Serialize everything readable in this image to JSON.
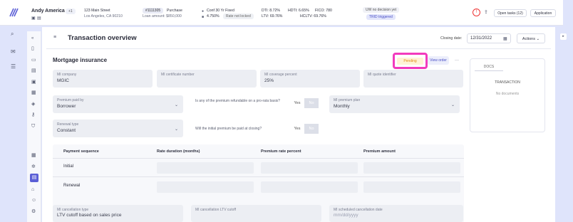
{
  "header": {
    "name": "Andy America",
    "count_badge": "+1",
    "address_line1": "123 Main Street",
    "address_line2": "Los Angeles, CA 90210",
    "loan_number": "#1111305",
    "loan_purpose": "Purchase",
    "loan_amount": "Loan amount: $850,000",
    "product": "Conf 30 Yr Fixed",
    "rate": "4.750%",
    "rate_lock": "Rate not locked",
    "dti": "DTI: 8.72%",
    "hdti": "HDTI: 6.65%",
    "fico": "FICO: 780",
    "ltv": "LTV: 69.76%",
    "hcltv": "HCLTV: 69.76%",
    "uw_status": "UW no decision yet",
    "trid": "TRID triggered",
    "open_tasks": "Open tasks (12)",
    "application": "Application"
  },
  "page": {
    "title": "Transaction overview",
    "closing_date_label": "Closing date:",
    "closing_date": "12/31/2022",
    "actions": "Actions"
  },
  "section": {
    "title": "Mortgage insurance",
    "status": "Pending",
    "view_order": "View order",
    "more": "···"
  },
  "fields": {
    "mi_company": {
      "label": "MI company",
      "value": "MGIC"
    },
    "mi_certificate": {
      "label": "MI certificate number",
      "value": ""
    },
    "mi_coverage": {
      "label": "MI coverage percent",
      "value": "25%"
    },
    "mi_quote": {
      "label": "MI quote identifier",
      "value": ""
    },
    "premium_paid_by": {
      "label": "Premium paid by",
      "value": "Borrower"
    },
    "refundable_q": "Is any of the premium refundable on a pro-rata basis?",
    "mi_premium_plan": {
      "label": "MI premium plan",
      "value": "Monthly"
    },
    "renewal_type": {
      "label": "Renewal type",
      "value": "Constant"
    },
    "initial_paid_q": "Will the initial premium be paid at closing?",
    "yes": "Yes",
    "no": "No",
    "cancellation_type": {
      "label": "MI cancellation type",
      "value": "LTV cutoff based on sales price"
    },
    "cancellation_ltv": {
      "label": "MI cancellation LTV cutoff",
      "value": ""
    },
    "scheduled_cancellation": {
      "label": "MI scheduled cancellation date",
      "placeholder": "mm/dd/yyyy"
    }
  },
  "table": {
    "headers": [
      "Payment sequence",
      "Rate duration (months)",
      "Premium rate percent",
      "Premium amount"
    ],
    "rows": [
      "Initial",
      "Renewal"
    ]
  },
  "docs": {
    "tab": "DOCS",
    "heading": "TRANSACTION",
    "empty": "No documents"
  },
  "colors": {
    "accent": "#5b5fd6",
    "highlight": "#f23bbd",
    "pending_bg": "#fff3d6",
    "pending_text": "#e08a12"
  }
}
